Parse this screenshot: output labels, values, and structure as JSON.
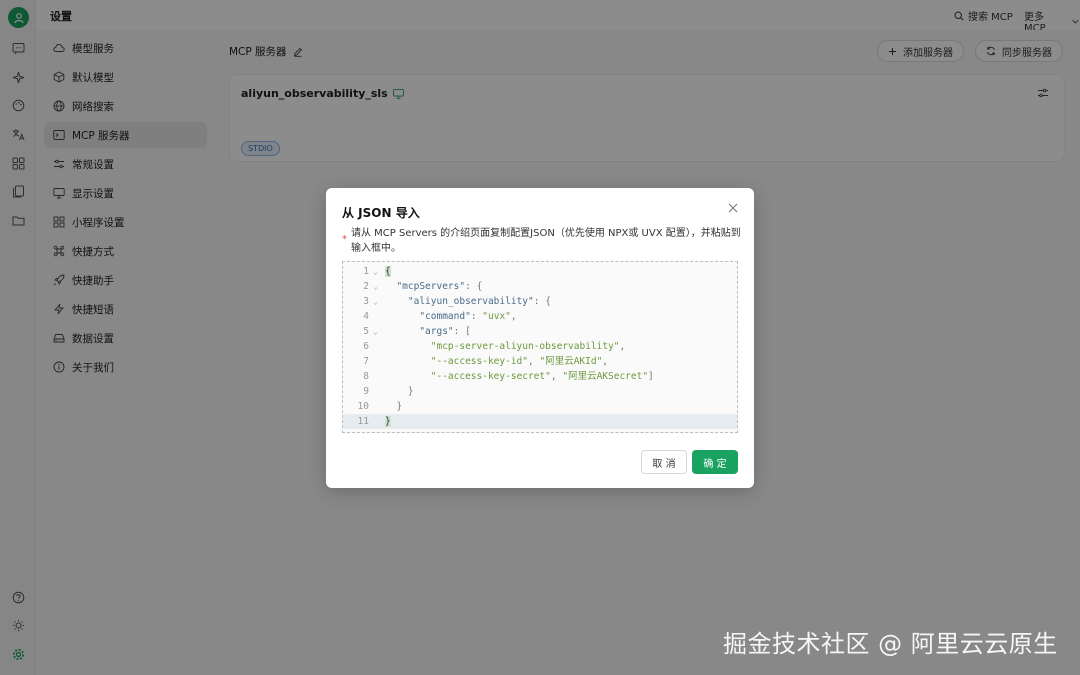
{
  "header": {
    "title": "设置",
    "search_label": "搜索 MCP",
    "more_label": "更多 MCP"
  },
  "rail": {
    "icons": [
      "chat-icon",
      "sparkle-icon",
      "palette-icon",
      "translate-icon",
      "apps-icon",
      "files-icon",
      "folder-icon",
      "help-icon",
      "theme-icon",
      "settings-icon"
    ]
  },
  "sidebar": {
    "items": [
      {
        "label": "模型服务",
        "icon": "cloud-icon"
      },
      {
        "label": "默认模型",
        "icon": "cube-icon"
      },
      {
        "label": "网络搜索",
        "icon": "globe-icon"
      },
      {
        "label": "MCP 服务器",
        "icon": "terminal-icon"
      },
      {
        "label": "常规设置",
        "icon": "sliders-icon"
      },
      {
        "label": "显示设置",
        "icon": "monitor-icon"
      },
      {
        "label": "小程序设置",
        "icon": "grid-icon"
      },
      {
        "label": "快捷方式",
        "icon": "command-icon"
      },
      {
        "label": "快捷助手",
        "icon": "rocket-icon"
      },
      {
        "label": "快捷短语",
        "icon": "zap-icon"
      },
      {
        "label": "数据设置",
        "icon": "drive-icon"
      },
      {
        "label": "关于我们",
        "icon": "info-icon"
      }
    ]
  },
  "main": {
    "title": "MCP 服务器",
    "add_button": "添加服务器",
    "sync_button": "同步服务器",
    "server": {
      "name": "aliyun_observability_sls",
      "tag": "STDIO"
    }
  },
  "modal": {
    "title": "从 JSON 导入",
    "required_mark": "*",
    "description": "请从 MCP Servers 的介绍页面复制配置JSON（优先使用 NPX或 UVX 配置），并粘贴到输入框中。",
    "code_lines": [
      "{",
      "  \"mcpServers\": {",
      "    \"aliyun_observability\": {",
      "      \"command\": \"uvx\",",
      "      \"args\": [",
      "        \"mcp-server-aliyun-observability\",",
      "        \"--access-key-id\", \"阿里云AKId\",",
      "        \"--access-key-secret\", \"阿里云AKSecret\"]",
      "    }",
      "  }",
      "}"
    ],
    "fold_lines": [
      1,
      2,
      3,
      5
    ],
    "cancel_label": "取 消",
    "ok_label": "确 定"
  },
  "watermark": "掘金技术社区 @ 阿里云云原生",
  "colors": {
    "accent": "#1aa260",
    "tag_border": "#8fb6e6",
    "tag_text": "#3b6fb6"
  }
}
